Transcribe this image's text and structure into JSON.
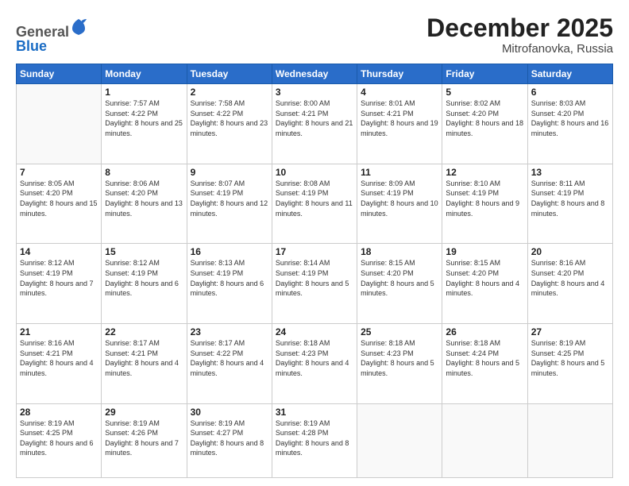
{
  "header": {
    "logo": {
      "line1": "General",
      "line2": "Blue"
    },
    "title": "December 2025",
    "location": "Mitrofanovka, Russia"
  },
  "weekdays": [
    "Sunday",
    "Monday",
    "Tuesday",
    "Wednesday",
    "Thursday",
    "Friday",
    "Saturday"
  ],
  "weeks": [
    [
      {
        "day": "",
        "sunrise": "",
        "sunset": "",
        "daylight": ""
      },
      {
        "day": "1",
        "sunrise": "Sunrise: 7:57 AM",
        "sunset": "Sunset: 4:22 PM",
        "daylight": "Daylight: 8 hours and 25 minutes."
      },
      {
        "day": "2",
        "sunrise": "Sunrise: 7:58 AM",
        "sunset": "Sunset: 4:22 PM",
        "daylight": "Daylight: 8 hours and 23 minutes."
      },
      {
        "day": "3",
        "sunrise": "Sunrise: 8:00 AM",
        "sunset": "Sunset: 4:21 PM",
        "daylight": "Daylight: 8 hours and 21 minutes."
      },
      {
        "day": "4",
        "sunrise": "Sunrise: 8:01 AM",
        "sunset": "Sunset: 4:21 PM",
        "daylight": "Daylight: 8 hours and 19 minutes."
      },
      {
        "day": "5",
        "sunrise": "Sunrise: 8:02 AM",
        "sunset": "Sunset: 4:20 PM",
        "daylight": "Daylight: 8 hours and 18 minutes."
      },
      {
        "day": "6",
        "sunrise": "Sunrise: 8:03 AM",
        "sunset": "Sunset: 4:20 PM",
        "daylight": "Daylight: 8 hours and 16 minutes."
      }
    ],
    [
      {
        "day": "7",
        "sunrise": "Sunrise: 8:05 AM",
        "sunset": "Sunset: 4:20 PM",
        "daylight": "Daylight: 8 hours and 15 minutes."
      },
      {
        "day": "8",
        "sunrise": "Sunrise: 8:06 AM",
        "sunset": "Sunset: 4:20 PM",
        "daylight": "Daylight: 8 hours and 13 minutes."
      },
      {
        "day": "9",
        "sunrise": "Sunrise: 8:07 AM",
        "sunset": "Sunset: 4:19 PM",
        "daylight": "Daylight: 8 hours and 12 minutes."
      },
      {
        "day": "10",
        "sunrise": "Sunrise: 8:08 AM",
        "sunset": "Sunset: 4:19 PM",
        "daylight": "Daylight: 8 hours and 11 minutes."
      },
      {
        "day": "11",
        "sunrise": "Sunrise: 8:09 AM",
        "sunset": "Sunset: 4:19 PM",
        "daylight": "Daylight: 8 hours and 10 minutes."
      },
      {
        "day": "12",
        "sunrise": "Sunrise: 8:10 AM",
        "sunset": "Sunset: 4:19 PM",
        "daylight": "Daylight: 8 hours and 9 minutes."
      },
      {
        "day": "13",
        "sunrise": "Sunrise: 8:11 AM",
        "sunset": "Sunset: 4:19 PM",
        "daylight": "Daylight: 8 hours and 8 minutes."
      }
    ],
    [
      {
        "day": "14",
        "sunrise": "Sunrise: 8:12 AM",
        "sunset": "Sunset: 4:19 PM",
        "daylight": "Daylight: 8 hours and 7 minutes."
      },
      {
        "day": "15",
        "sunrise": "Sunrise: 8:12 AM",
        "sunset": "Sunset: 4:19 PM",
        "daylight": "Daylight: 8 hours and 6 minutes."
      },
      {
        "day": "16",
        "sunrise": "Sunrise: 8:13 AM",
        "sunset": "Sunset: 4:19 PM",
        "daylight": "Daylight: 8 hours and 6 minutes."
      },
      {
        "day": "17",
        "sunrise": "Sunrise: 8:14 AM",
        "sunset": "Sunset: 4:19 PM",
        "daylight": "Daylight: 8 hours and 5 minutes."
      },
      {
        "day": "18",
        "sunrise": "Sunrise: 8:15 AM",
        "sunset": "Sunset: 4:20 PM",
        "daylight": "Daylight: 8 hours and 5 minutes."
      },
      {
        "day": "19",
        "sunrise": "Sunrise: 8:15 AM",
        "sunset": "Sunset: 4:20 PM",
        "daylight": "Daylight: 8 hours and 4 minutes."
      },
      {
        "day": "20",
        "sunrise": "Sunrise: 8:16 AM",
        "sunset": "Sunset: 4:20 PM",
        "daylight": "Daylight: 8 hours and 4 minutes."
      }
    ],
    [
      {
        "day": "21",
        "sunrise": "Sunrise: 8:16 AM",
        "sunset": "Sunset: 4:21 PM",
        "daylight": "Daylight: 8 hours and 4 minutes."
      },
      {
        "day": "22",
        "sunrise": "Sunrise: 8:17 AM",
        "sunset": "Sunset: 4:21 PM",
        "daylight": "Daylight: 8 hours and 4 minutes."
      },
      {
        "day": "23",
        "sunrise": "Sunrise: 8:17 AM",
        "sunset": "Sunset: 4:22 PM",
        "daylight": "Daylight: 8 hours and 4 minutes."
      },
      {
        "day": "24",
        "sunrise": "Sunrise: 8:18 AM",
        "sunset": "Sunset: 4:23 PM",
        "daylight": "Daylight: 8 hours and 4 minutes."
      },
      {
        "day": "25",
        "sunrise": "Sunrise: 8:18 AM",
        "sunset": "Sunset: 4:23 PM",
        "daylight": "Daylight: 8 hours and 5 minutes."
      },
      {
        "day": "26",
        "sunrise": "Sunrise: 8:18 AM",
        "sunset": "Sunset: 4:24 PM",
        "daylight": "Daylight: 8 hours and 5 minutes."
      },
      {
        "day": "27",
        "sunrise": "Sunrise: 8:19 AM",
        "sunset": "Sunset: 4:25 PM",
        "daylight": "Daylight: 8 hours and 5 minutes."
      }
    ],
    [
      {
        "day": "28",
        "sunrise": "Sunrise: 8:19 AM",
        "sunset": "Sunset: 4:25 PM",
        "daylight": "Daylight: 8 hours and 6 minutes."
      },
      {
        "day": "29",
        "sunrise": "Sunrise: 8:19 AM",
        "sunset": "Sunset: 4:26 PM",
        "daylight": "Daylight: 8 hours and 7 minutes."
      },
      {
        "day": "30",
        "sunrise": "Sunrise: 8:19 AM",
        "sunset": "Sunset: 4:27 PM",
        "daylight": "Daylight: 8 hours and 8 minutes."
      },
      {
        "day": "31",
        "sunrise": "Sunrise: 8:19 AM",
        "sunset": "Sunset: 4:28 PM",
        "daylight": "Daylight: 8 hours and 8 minutes."
      },
      {
        "day": "",
        "sunrise": "",
        "sunset": "",
        "daylight": ""
      },
      {
        "day": "",
        "sunrise": "",
        "sunset": "",
        "daylight": ""
      },
      {
        "day": "",
        "sunrise": "",
        "sunset": "",
        "daylight": ""
      }
    ]
  ]
}
